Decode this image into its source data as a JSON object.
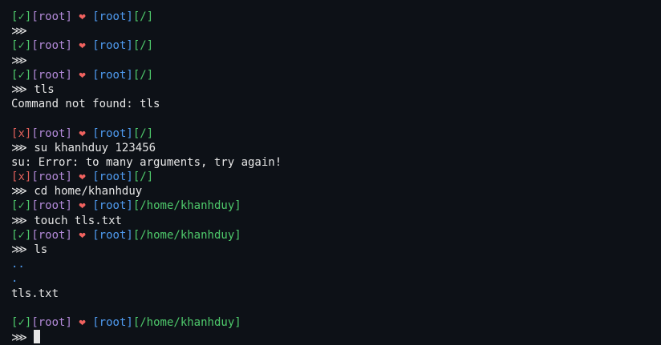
{
  "terminal": {
    "colors": {
      "background": "#0d1117",
      "ok": "#4ec96b",
      "error": "#e0605a",
      "user": "#b38ad9",
      "heart": "#f0625f",
      "host": "#4f9bf0",
      "path": "#4ec96b",
      "text": "#e6e6e6"
    },
    "lines": [
      {
        "type": "prompt",
        "status": "✓",
        "status_kind": "ok",
        "user": "root",
        "heart": "❤",
        "host": "root",
        "path": "/"
      },
      {
        "type": "input",
        "arrow": "⋙",
        "command": ""
      },
      {
        "type": "prompt",
        "status": "✓",
        "status_kind": "ok",
        "user": "root",
        "heart": "❤",
        "host": "root",
        "path": "/"
      },
      {
        "type": "input",
        "arrow": "⋙",
        "command": ""
      },
      {
        "type": "prompt",
        "status": "✓",
        "status_kind": "ok",
        "user": "root",
        "heart": "❤",
        "host": "root",
        "path": "/"
      },
      {
        "type": "input",
        "arrow": "⋙",
        "command": "tls"
      },
      {
        "type": "output",
        "text": "Command not found: tls"
      },
      {
        "type": "blank"
      },
      {
        "type": "prompt",
        "status": "x",
        "status_kind": "err",
        "user": "root",
        "heart": "❤",
        "host": "root",
        "path": "/"
      },
      {
        "type": "input",
        "arrow": "⋙",
        "command": "su khanhduy 123456"
      },
      {
        "type": "output",
        "text": "su: Error: to many arguments, try again!"
      },
      {
        "type": "prompt",
        "status": "x",
        "status_kind": "err",
        "user": "root",
        "heart": "❤",
        "host": "root",
        "path": "/"
      },
      {
        "type": "input",
        "arrow": "⋙",
        "command": "cd home/khanhduy"
      },
      {
        "type": "prompt",
        "status": "✓",
        "status_kind": "ok",
        "user": "root",
        "heart": "❤",
        "host": "root",
        "path": "/home/khanhduy"
      },
      {
        "type": "input",
        "arrow": "⋙",
        "command": "touch tls.txt"
      },
      {
        "type": "prompt",
        "status": "✓",
        "status_kind": "ok",
        "user": "root",
        "heart": "❤",
        "host": "root",
        "path": "/home/khanhduy"
      },
      {
        "type": "input",
        "arrow": "⋙",
        "command": "ls"
      },
      {
        "type": "dir",
        "text": ".."
      },
      {
        "type": "dir",
        "text": "."
      },
      {
        "type": "output",
        "text": "tls.txt"
      },
      {
        "type": "blank"
      },
      {
        "type": "prompt",
        "status": "✓",
        "status_kind": "ok",
        "user": "root",
        "heart": "❤",
        "host": "root",
        "path": "/home/khanhduy"
      },
      {
        "type": "input",
        "arrow": "⋙",
        "command": "",
        "cursor": true
      }
    ]
  }
}
